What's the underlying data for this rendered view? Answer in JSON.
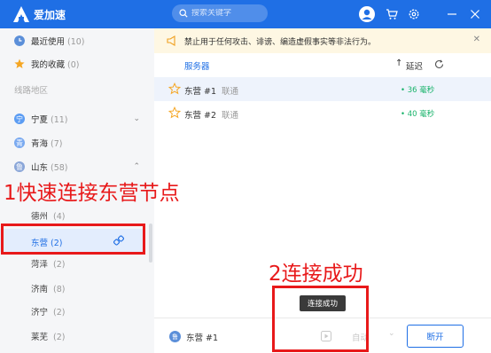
{
  "app": {
    "title": "爱加速"
  },
  "search": {
    "placeholder": "搜索关键字"
  },
  "sidebar": {
    "recent": {
      "label": "最近使用",
      "count": "(10)"
    },
    "favorites": {
      "label": "我的收藏",
      "count": "(0)"
    },
    "section_title": "线路地区",
    "regions": [
      {
        "label": "宁夏",
        "count": "(11)",
        "icon_color": "#5b9cf3",
        "glyph": "宁"
      },
      {
        "label": "青海",
        "count": "(7)",
        "icon_color": "#7aaaf0",
        "glyph": "青"
      },
      {
        "label": "山东",
        "count": "(58)",
        "icon_color": "#8aa6d8",
        "glyph": "鲁"
      }
    ],
    "cities": [
      {
        "label": "德州",
        "count": "(4)"
      },
      {
        "label": "东营",
        "count": "(2)"
      },
      {
        "label": "菏泽",
        "count": "(2)"
      },
      {
        "label": "济南",
        "count": "(8)"
      },
      {
        "label": "济宁",
        "count": "(2)"
      },
      {
        "label": "莱芜",
        "count": "(2)"
      }
    ]
  },
  "notice": {
    "text": "禁止用于任何攻击、诽谤、编造虚假事实等非法行为。"
  },
  "table": {
    "col_server": "服务器",
    "col_latency": "延迟"
  },
  "servers": [
    {
      "name": "东营 #1",
      "isp": "联通",
      "latency": "• 36 毫秒"
    },
    {
      "name": "东营 #2",
      "isp": "联通",
      "latency": "• 40 毫秒"
    }
  ],
  "bottom": {
    "current": "东营 #1",
    "auto_label": "自动",
    "disconnect_label": "断开"
  },
  "toast": {
    "text": "连接成功"
  },
  "annotations": {
    "step1": "1快速连接东营节点",
    "step2": "2连接成功"
  },
  "colors": {
    "brand": "#1f6fe5",
    "latency_ok": "#19b36b",
    "annotation": "#e8191a",
    "star": "#f5a623"
  }
}
